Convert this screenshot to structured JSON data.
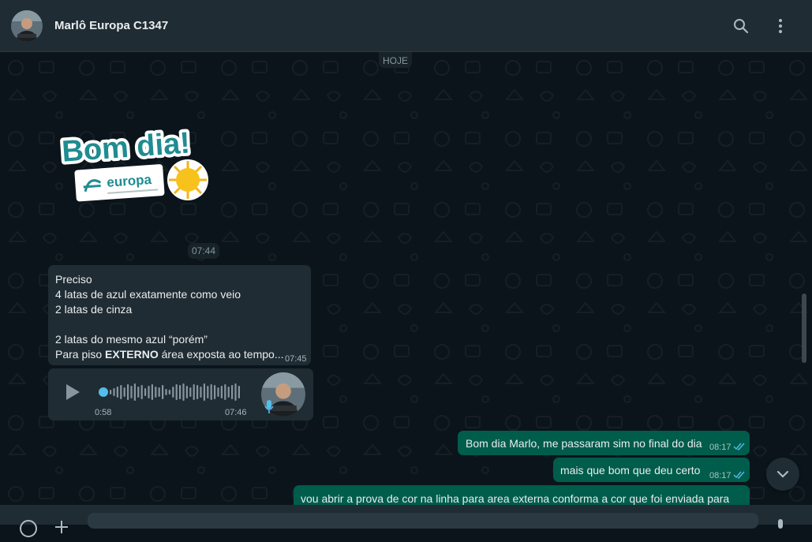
{
  "header": {
    "contact_name": "Marlô Europa C1347",
    "icons": [
      "avatar",
      "search-icon",
      "menu-dots-icon"
    ]
  },
  "date_divider": "HOJE",
  "sticker": {
    "time": "07:44"
  },
  "messages_in": {
    "text_lines": [
      "Preciso",
      "4 latas de azul exatamente como veio",
      "2 latas de cinza",
      "",
      "2 latas do mesmo azul “porém”"
    ],
    "last_line_prefix": "Para piso ",
    "last_line_bold": "EXTERNO",
    "last_line_suffix": " área exposta ao tempo...",
    "time": "07:45"
  },
  "voice_note": {
    "duration": "0:58",
    "time": "07:46"
  },
  "messages_out": [
    {
      "text": "Bom dia Marlo, me passaram sim no final do dia",
      "time": "08:17"
    },
    {
      "text": "mais que bom que deu certo",
      "time": "08:17"
    },
    {
      "text": "vou abrir a prova de cor na linha para area externa conforma a cor que foi enviada para"
    }
  ],
  "colors": {
    "header_bg": "#202c33",
    "chat_bg": "#0b141a",
    "incoming_bubble": "#202c33",
    "outgoing_bubble": "#005c4b",
    "read_ticks": "#53bdeb"
  }
}
